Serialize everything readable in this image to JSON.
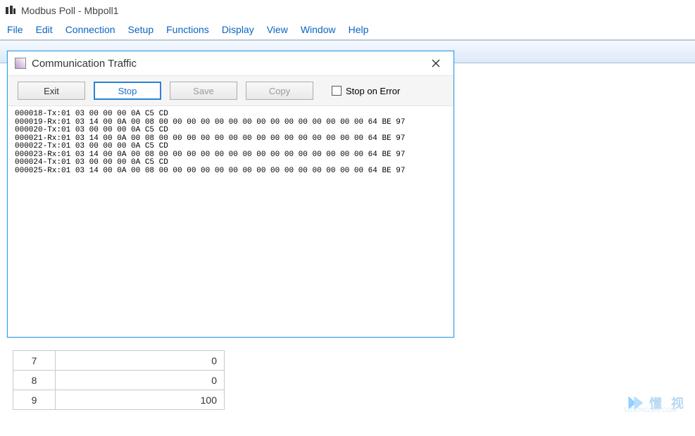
{
  "app": {
    "title": "Modbus Poll - Mbpoll1"
  },
  "menu": {
    "items": [
      "File",
      "Edit",
      "Connection",
      "Setup",
      "Functions",
      "Display",
      "View",
      "Window",
      "Help"
    ]
  },
  "dialog": {
    "title": "Communication Traffic",
    "buttons": {
      "exit": "Exit",
      "stop": "Stop",
      "save": "Save",
      "copy": "Copy"
    },
    "stop_on_error": "Stop on Error",
    "traffic_lines": [
      "000018-Tx:01 03 00 00 00 0A C5 CD",
      "000019-Rx:01 03 14 00 0A 00 08 00 00 00 00 00 00 00 00 00 00 00 00 00 00 00 64 BE 97",
      "000020-Tx:01 03 00 00 00 0A C5 CD",
      "000021-Rx:01 03 14 00 0A 00 08 00 00 00 00 00 00 00 00 00 00 00 00 00 00 00 64 BE 97",
      "000022-Tx:01 03 00 00 00 0A C5 CD",
      "000023-Rx:01 03 14 00 0A 00 08 00 00 00 00 00 00 00 00 00 00 00 00 00 00 00 64 BE 97",
      "000024-Tx:01 03 00 00 00 0A C5 CD",
      "000025-Rx:01 03 14 00 0A 00 08 00 00 00 00 00 00 00 00 00 00 00 00 00 00 00 64 BE 97"
    ]
  },
  "table": {
    "rows": [
      {
        "index": "7",
        "value": "0"
      },
      {
        "index": "8",
        "value": "0"
      },
      {
        "index": "9",
        "value": "100"
      }
    ]
  },
  "watermark": {
    "text": "懂 视",
    "sub": "51DONGSHI.COM"
  }
}
